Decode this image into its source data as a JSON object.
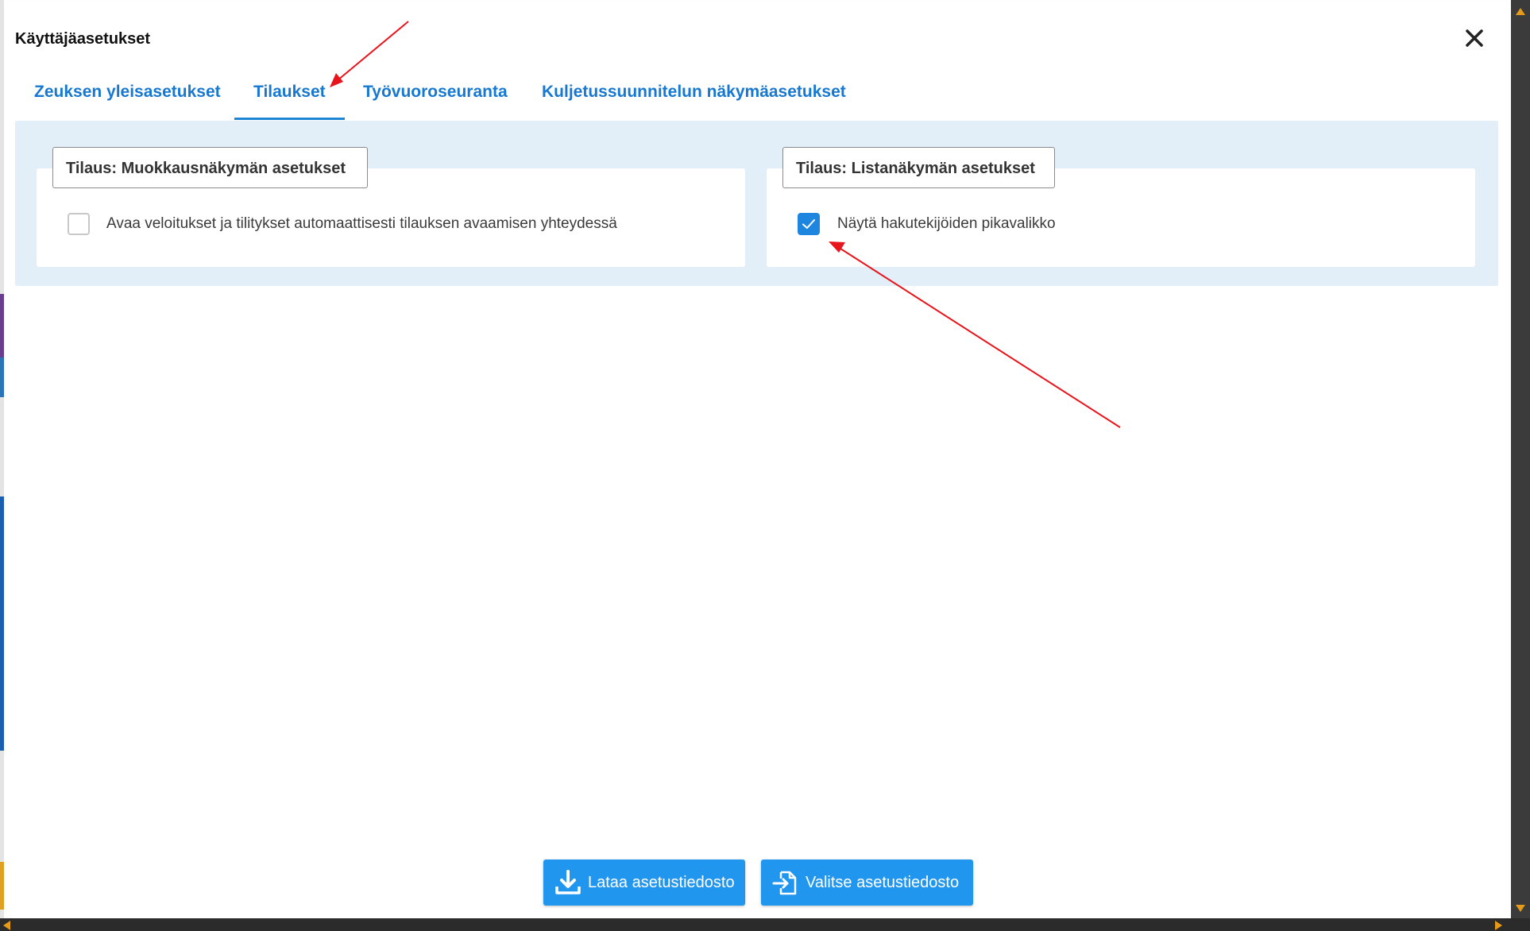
{
  "dialog": {
    "title": "Käyttäjäasetukset",
    "close_icon": "close-icon"
  },
  "tabs": [
    {
      "label": "Zeuksen yleisasetukset",
      "active": false
    },
    {
      "label": "Tilaukset",
      "active": true
    },
    {
      "label": "Työvuoroseuranta",
      "active": false
    },
    {
      "label": "Kuljetussuunnitelun näkymäasetukset",
      "active": false
    }
  ],
  "sections": {
    "edit_view": {
      "legend": "Tilaus: Muokkausnäkymän asetukset",
      "option_label": "Avaa veloitukset ja tilitykset automaattisesti tilauksen avaamisen yhteydessä",
      "checked": false
    },
    "list_view": {
      "legend": "Tilaus: Listanäkymän asetukset",
      "option_label": "Näytä hakutekijöiden pikavalikko",
      "checked": true
    }
  },
  "footer": {
    "download_label": "Lataa asetustiedosto",
    "download_icon": "download-icon",
    "choose_label": "Valitse asetustiedosto",
    "choose_icon": "file-import-icon"
  },
  "colors": {
    "accent": "#1678d1",
    "button": "#2196ee",
    "content_bg": "#e3eff8",
    "annotation": "#e8141b",
    "scroll_arrow": "#e69a1a"
  }
}
